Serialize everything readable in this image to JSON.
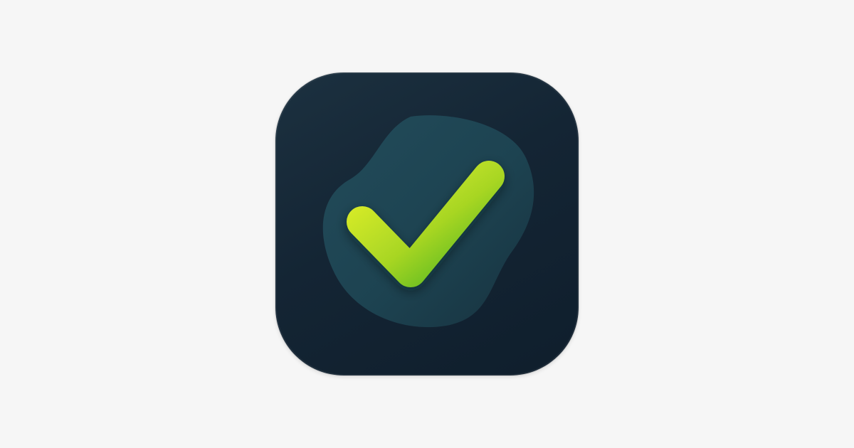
{
  "page": {
    "background_color": "#f6f6f6"
  },
  "app_icon": {
    "icon_name": "checkmark-app-icon",
    "tile_color": "#142534",
    "blob_color": "#1d4351",
    "check_gradient_start": "#e2f02a",
    "check_gradient_end": "#4cb41c"
  }
}
